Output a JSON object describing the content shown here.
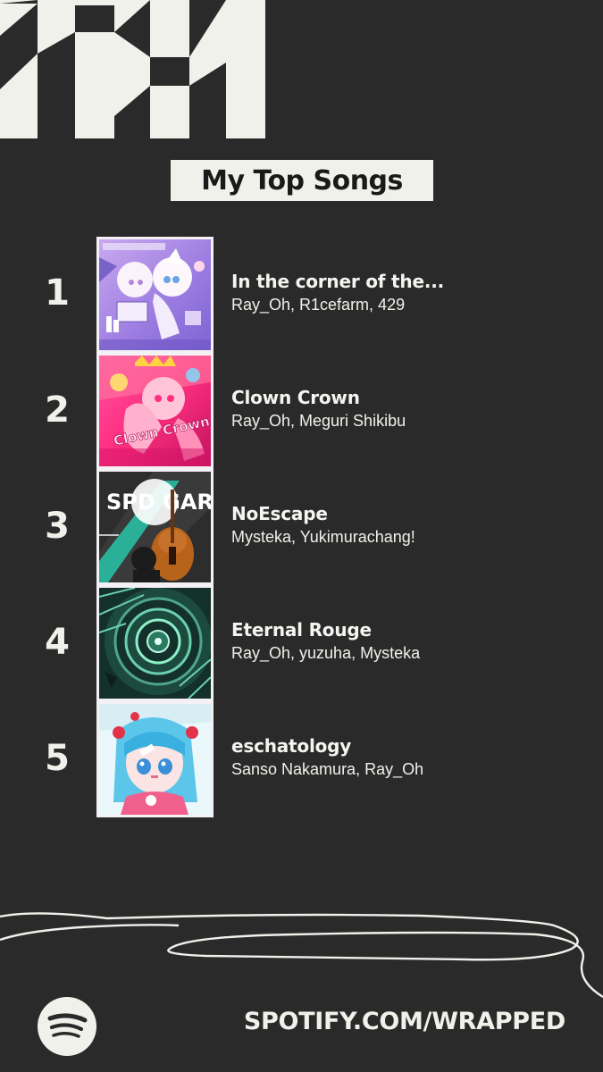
{
  "header": {
    "title": "My Top Songs"
  },
  "songs": [
    {
      "rank": "1",
      "title": "In the corner of the...",
      "artists": "Ray_Oh, R1cefarm, 429",
      "cover_icon": "album-cover-anime-girls-purple"
    },
    {
      "rank": "2",
      "title": "Clown Crown",
      "artists": "Ray_Oh, Meguri Shikibu",
      "cover_icon": "album-cover-clown-crown-pink"
    },
    {
      "rank": "3",
      "title": "NoEscape",
      "artists": "Mysteka, Yukimurachang!",
      "cover_icon": "album-cover-spd-gar-cello"
    },
    {
      "rank": "4",
      "title": "Eternal Rouge",
      "artists": "Ray_Oh, yuzuha, Mysteka",
      "cover_icon": "album-cover-spiral-staircase-green"
    },
    {
      "rank": "5",
      "title": "eschatology",
      "artists": "Sanso Nakamura, Ray_Oh",
      "cover_icon": "album-cover-blue-hair-girl"
    }
  ],
  "cover_art_text": {
    "cover2": "Clown Crown",
    "cover3": "SPD GAR"
  },
  "footer": {
    "link": "SPOTIFY.COM/WRAPPED",
    "logo_icon": "spotify-logo-icon"
  },
  "colors": {
    "background": "#2a2a2a",
    "foreground": "#f1f1ec",
    "title_text": "#1a1a1a"
  }
}
